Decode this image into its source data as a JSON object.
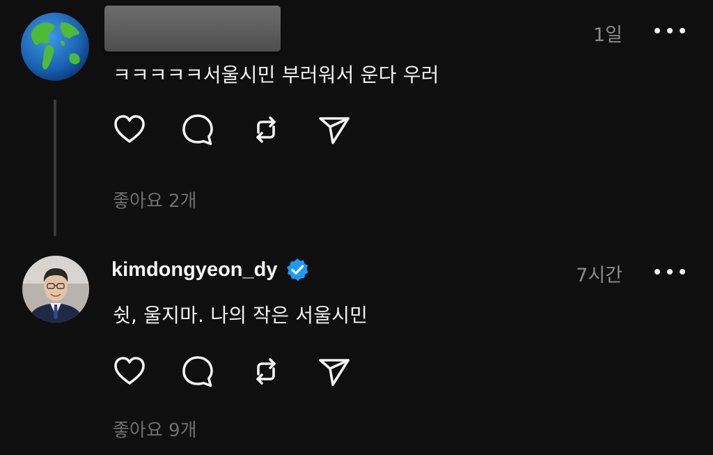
{
  "post1": {
    "username": "",
    "time": "1일",
    "text": "ㅋㅋㅋㅋㅋ서울시민 부러워서 운다 우러",
    "likes": "좋아요 2개",
    "avatar_icon": "globe-icon"
  },
  "post2": {
    "username": "kimdongyeon_dy",
    "verified_icon": "verified-badge-icon",
    "time": "7시간",
    "text": "쉿, 울지마. 나의 작은 서울시민",
    "likes": "좋아요 9개",
    "avatar_icon": "profile-photo"
  },
  "icons": {
    "like": "heart-icon",
    "reply": "comment-bubble-icon",
    "repost": "repost-icon",
    "share": "send-icon",
    "more": "more-dots-icon"
  },
  "colors": {
    "background": "#0f0f0f",
    "text": "#f3f3f3",
    "muted": "#8b8b8b",
    "verified": "#1d9bf0"
  }
}
